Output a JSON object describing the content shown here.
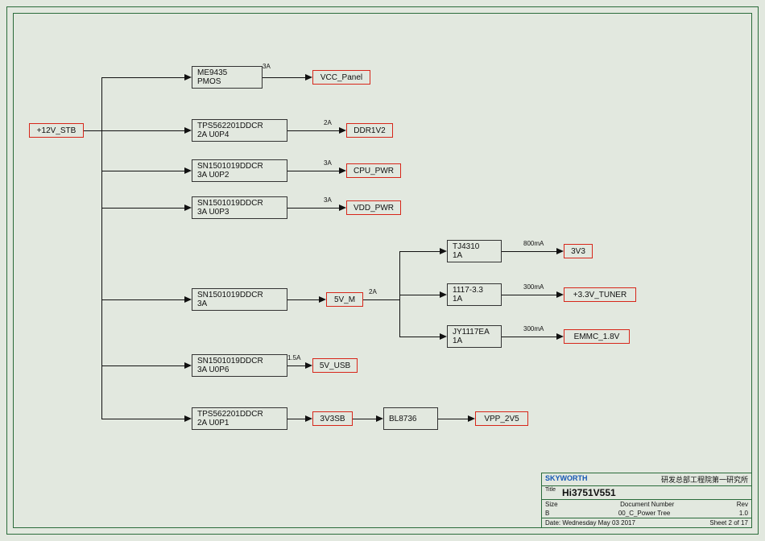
{
  "input": {
    "label": "+12V_STB"
  },
  "regs": {
    "me9435": {
      "l1": "ME9435",
      "l2": "PMOS",
      "amp": "3A"
    },
    "tps04": {
      "l1": "TPS562201DDCR",
      "l2": "2A    U0P4",
      "amp": "2A"
    },
    "sn02": {
      "l1": "SN1501019DDCR",
      "l2": "3A    U0P2",
      "amp": "3A"
    },
    "sn03": {
      "l1": "SN1501019DDCR",
      "l2": "3A    U0P3",
      "amp": "3A"
    },
    "sn3a": {
      "l1": "SN1501019DDCR",
      "l2": "3A",
      "amp": "2A"
    },
    "sn06": {
      "l1": "SN1501019DDCR",
      "l2": "3A    U0P6",
      "amp": "1.5A"
    },
    "tps01": {
      "l1": "TPS562201DDCR",
      "l2": "2A    U0P1",
      "amp": ""
    },
    "tj4310": {
      "l1": "TJ4310",
      "l2": "1A",
      "amp": "800mA"
    },
    "ldo1117": {
      "l1": "1117-3.3",
      "l2": "1A",
      "amp": "300mA"
    },
    "jy1117": {
      "l1": "JY1117EA",
      "l2": "1A",
      "amp": "300mA"
    },
    "bl8736": {
      "l1": "BL8736",
      "l2": "",
      "amp": ""
    }
  },
  "outputs": {
    "vcc_panel": "VCC_Panel",
    "ddr1v2": "DDR1V2",
    "cpu_pwr": "CPU_PWR",
    "vdd_pwr": "VDD_PWR",
    "v5m": "5V_M",
    "v5usb": "5V_USB",
    "v3v3sb": "3V3SB",
    "v3v3": "3V3",
    "v33tuner": "+3.3V_TUNER",
    "emmc18": "EMMC_1.8V",
    "vpp2v5": "VPP_2V5"
  },
  "title_block": {
    "logo": "SKYWORTH",
    "org": "研发总部工程院第一研究所",
    "title_label": "Title",
    "title": "Hi3751V551",
    "size_label": "Size",
    "size": "B",
    "docnum_label": "Document Number",
    "docnum": "00_C_Power Tree",
    "rev_label": "Rev",
    "rev": "1.0",
    "date_label": "Date:",
    "date": "Wednesday  May 03  2017",
    "sheet_label": "Sheet",
    "sheet_cur": "2",
    "sheet_of": "of",
    "sheet_total": "17"
  }
}
